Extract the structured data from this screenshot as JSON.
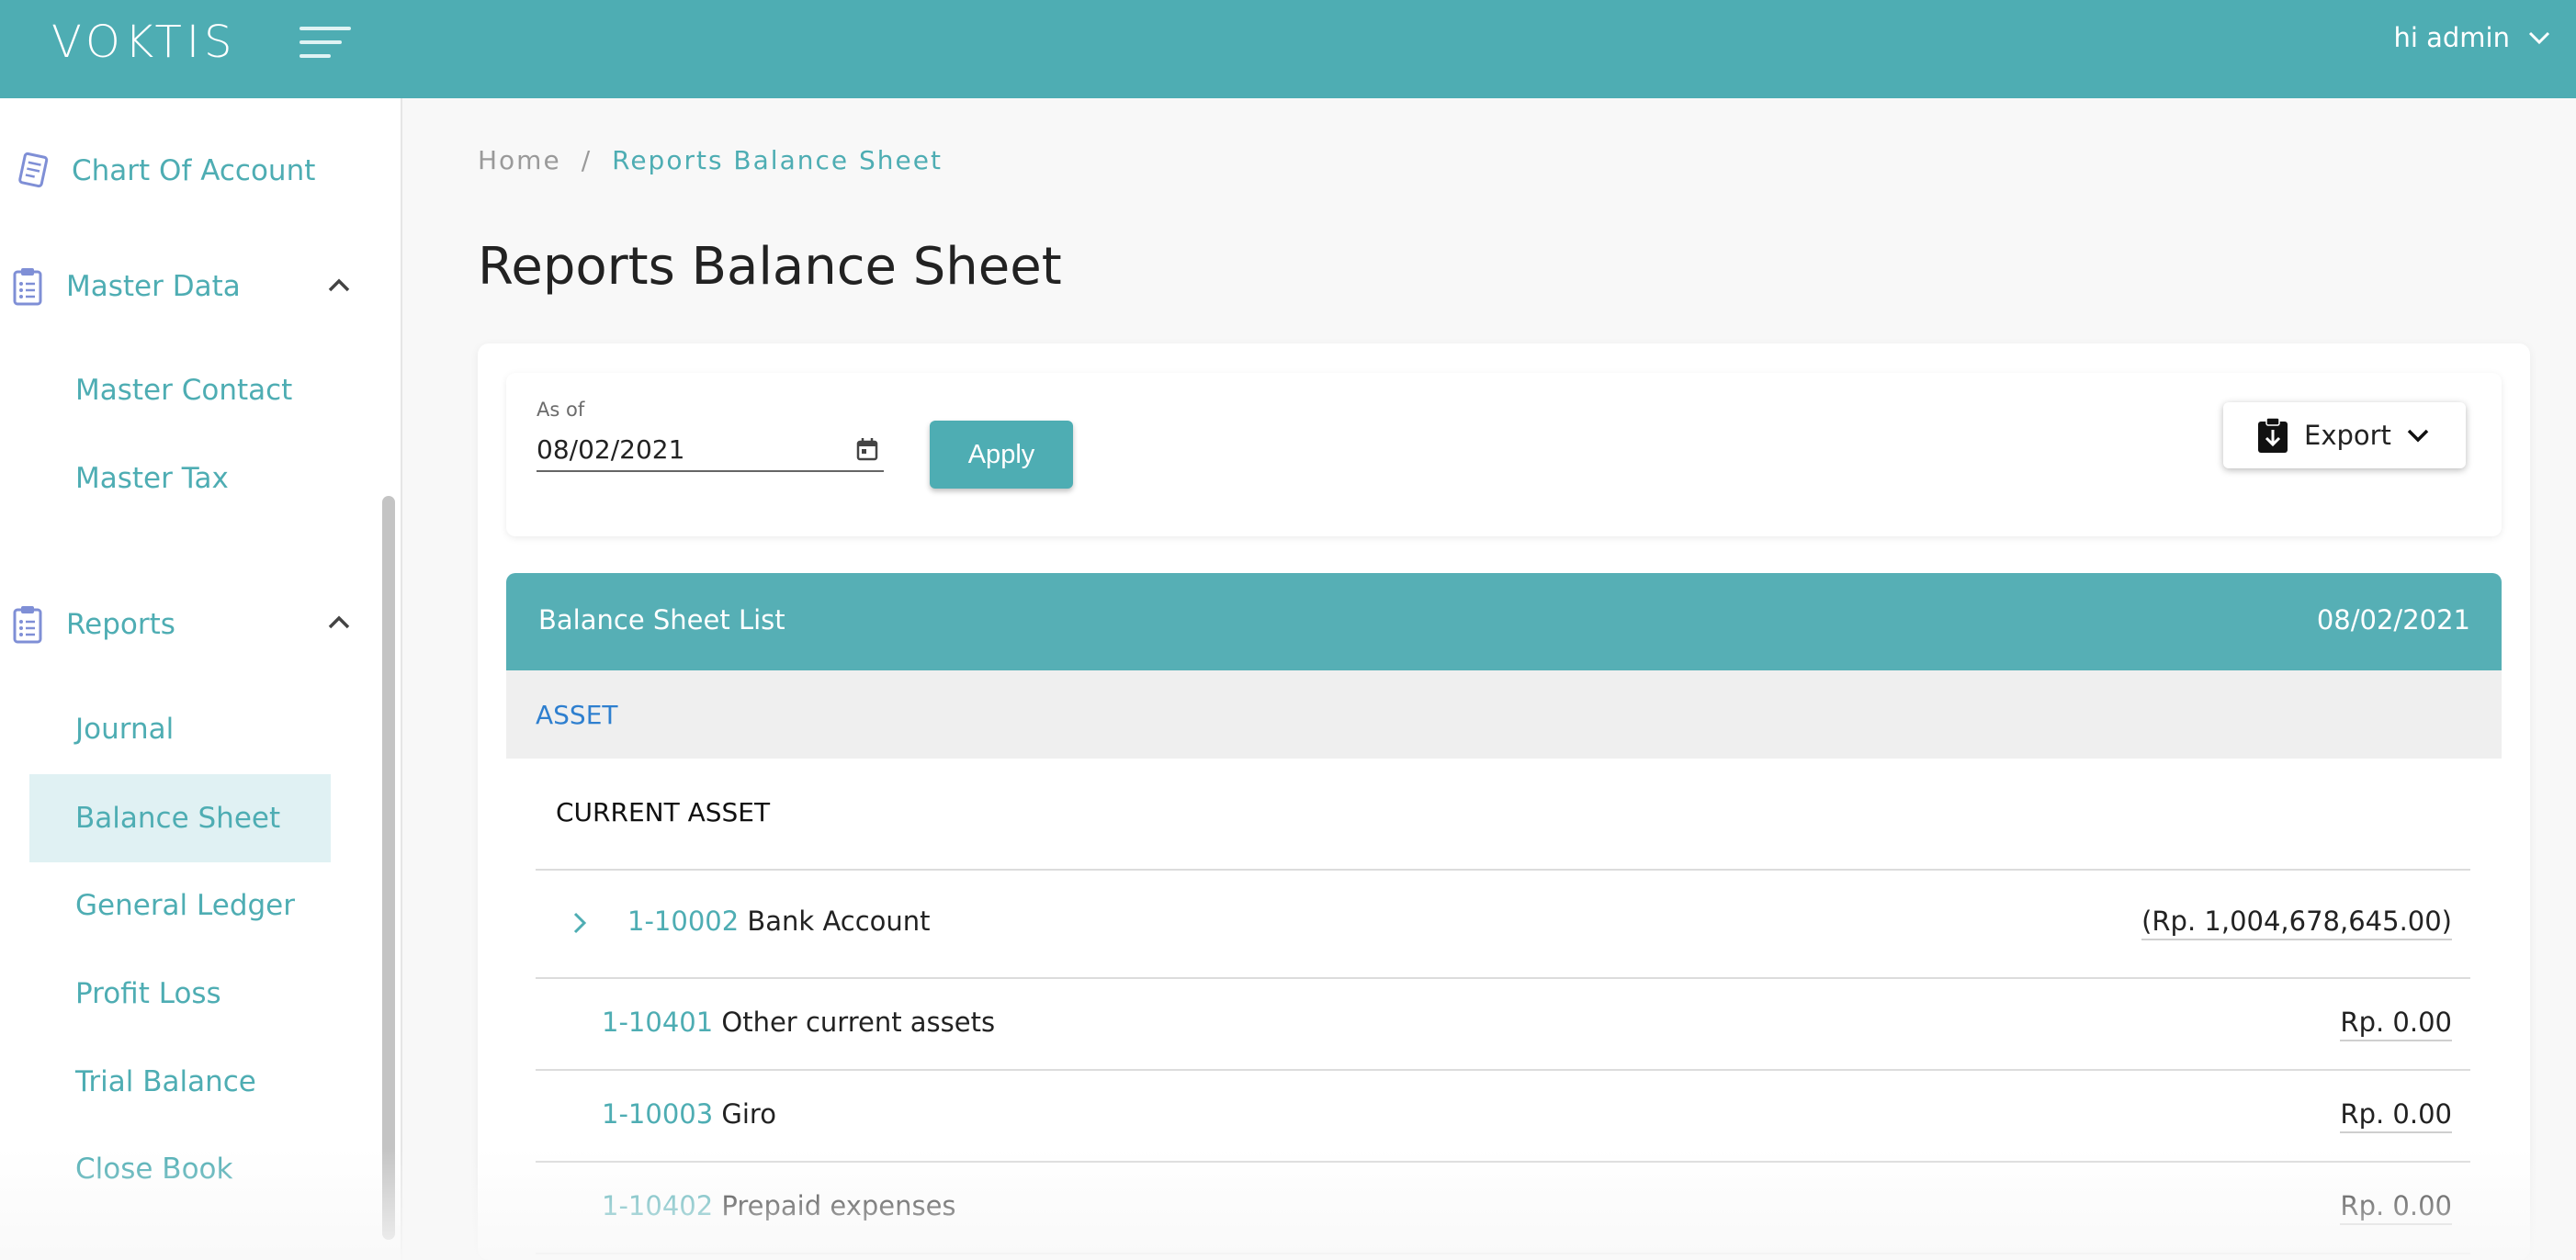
{
  "app": {
    "logo_text": "VOKTIS",
    "user_greeting": "hi admin",
    "accent_color": "#4eadb3"
  },
  "sidebar": {
    "top_item": {
      "label": "Chart Of Account",
      "icon": "ledger-icon"
    },
    "groups": [
      {
        "label": "Master Data",
        "icon": "clipboard-icon",
        "expanded": true,
        "items": [
          {
            "label": "Master Contact"
          },
          {
            "label": "Master Tax"
          }
        ]
      },
      {
        "label": "Reports",
        "icon": "clipboard-icon",
        "expanded": true,
        "items": [
          {
            "label": "Journal"
          },
          {
            "label": "Balance Sheet",
            "active": true
          },
          {
            "label": "General Ledger"
          },
          {
            "label": "Profit Loss"
          },
          {
            "label": "Trial Balance"
          },
          {
            "label": "Close Book"
          }
        ]
      }
    ]
  },
  "breadcrumb": {
    "home": "Home",
    "separator": "/",
    "current": "Reports Balance Sheet"
  },
  "page": {
    "title": "Reports Balance Sheet"
  },
  "filters": {
    "date_label": "As of",
    "date_value": "08/02/2021",
    "apply_label": "Apply",
    "export_label": "Export"
  },
  "balance_sheet": {
    "header_title": "Balance Sheet List",
    "header_date": "08/02/2021",
    "section": "ASSET",
    "subsection": "CURRENT ASSET",
    "rows": [
      {
        "code": "1-10002",
        "name": "Bank Account",
        "amount": "(Rp. 1,004,678,645.00)",
        "expandable": true
      },
      {
        "code": "1-10401",
        "name": "Other current assets",
        "amount": "Rp. 0.00",
        "expandable": false
      },
      {
        "code": "1-10003",
        "name": "Giro",
        "amount": "Rp. 0.00",
        "expandable": false
      },
      {
        "code": "1-10402",
        "name": "Prepaid expenses",
        "amount": "Rp. 0.00",
        "expandable": false
      }
    ]
  }
}
